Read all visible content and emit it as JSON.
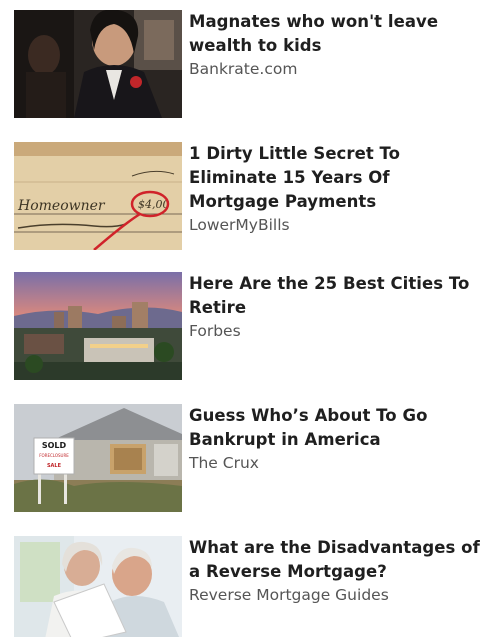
{
  "feed": {
    "items": [
      {
        "headline": "Magnates who won't leave wealth to kids",
        "source": "Bankrate.com",
        "thumb_icon": "man-in-suit-photo-icon"
      },
      {
        "headline": "1 Dirty Little Secret To Eliminate 15 Years Of Mortgage Payments",
        "source": "LowerMyBills",
        "thumb_icon": "handwritten-check-photo-icon"
      },
      {
        "headline": "Here Are the 25 Best Cities To Retire",
        "source": "Forbes",
        "thumb_icon": "city-skyline-photo-icon"
      },
      {
        "headline": "Guess Who’s About To Go Bankrupt in America",
        "source": "The Crux",
        "thumb_icon": "foreclosed-house-photo-icon"
      },
      {
        "headline": "What are the Disadvantages of a Reverse Mortgage?",
        "source": "Reverse Mortgage Guides",
        "thumb_icon": "elderly-couple-photo-icon"
      }
    ],
    "thumb_text": {
      "check_payee": "Homeowner",
      "check_amount": "$4,00",
      "sign_line1": "SOLD",
      "sign_line2": "FORECLOSURE",
      "sign_line3": "SALE"
    }
  }
}
